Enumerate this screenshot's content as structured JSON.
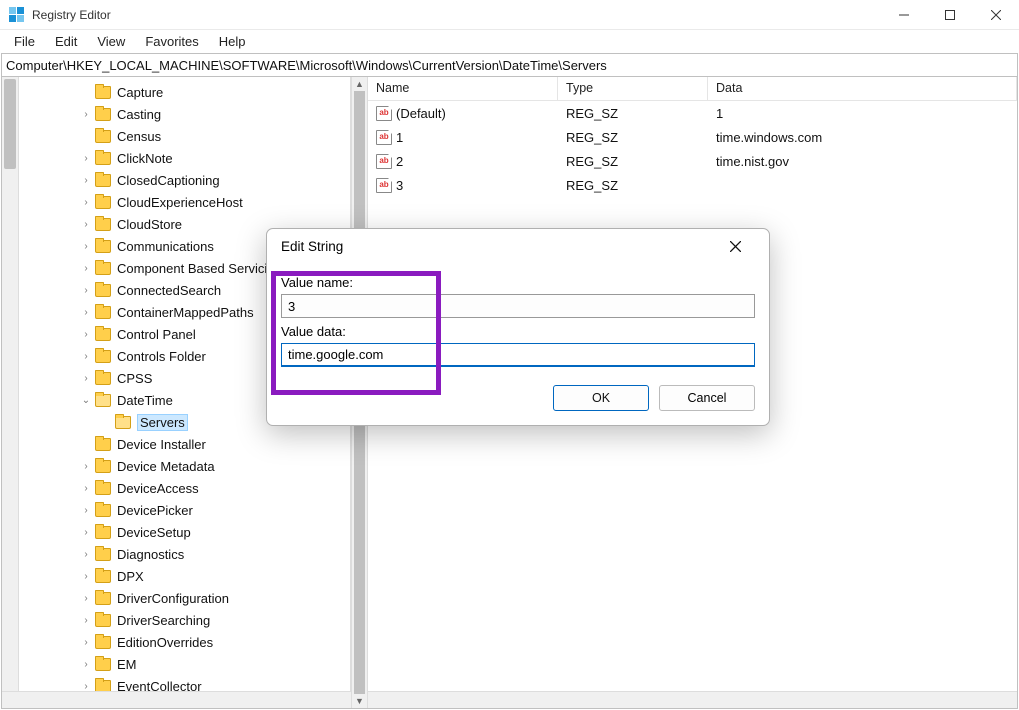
{
  "window": {
    "title": "Registry Editor"
  },
  "menu": {
    "file": "File",
    "edit": "Edit",
    "view": "View",
    "favorites": "Favorites",
    "help": "Help"
  },
  "address": "Computer\\HKEY_LOCAL_MACHINE\\SOFTWARE\\Microsoft\\Windows\\CurrentVersion\\DateTime\\Servers",
  "tree": [
    {
      "label": "Capture",
      "exp": ""
    },
    {
      "label": "Casting",
      "exp": ">"
    },
    {
      "label": "Census",
      "exp": ""
    },
    {
      "label": "ClickNote",
      "exp": ">"
    },
    {
      "label": "ClosedCaptioning",
      "exp": ">"
    },
    {
      "label": "CloudExperienceHost",
      "exp": ">"
    },
    {
      "label": "CloudStore",
      "exp": ">"
    },
    {
      "label": "Communications",
      "exp": ">"
    },
    {
      "label": "Component Based Servicing",
      "exp": ">"
    },
    {
      "label": "ConnectedSearch",
      "exp": ">"
    },
    {
      "label": "ContainerMappedPaths",
      "exp": ">"
    },
    {
      "label": "Control Panel",
      "exp": ">"
    },
    {
      "label": "Controls Folder",
      "exp": ">"
    },
    {
      "label": "CPSS",
      "exp": ">"
    },
    {
      "label": "DateTime",
      "exp": "v",
      "open": true
    },
    {
      "label": "Servers",
      "exp": "",
      "depth": 2,
      "selected": true
    },
    {
      "label": "Device Installer",
      "exp": ""
    },
    {
      "label": "Device Metadata",
      "exp": ">"
    },
    {
      "label": "DeviceAccess",
      "exp": ">"
    },
    {
      "label": "DevicePicker",
      "exp": ">"
    },
    {
      "label": "DeviceSetup",
      "exp": ">"
    },
    {
      "label": "Diagnostics",
      "exp": ">"
    },
    {
      "label": "DPX",
      "exp": ">"
    },
    {
      "label": "DriverConfiguration",
      "exp": ">"
    },
    {
      "label": "DriverSearching",
      "exp": ">"
    },
    {
      "label": "EditionOverrides",
      "exp": ">"
    },
    {
      "label": "EM",
      "exp": ">"
    },
    {
      "label": "EventCollector",
      "exp": ">"
    }
  ],
  "columns": {
    "name": "Name",
    "type": "Type",
    "data": "Data"
  },
  "values": [
    {
      "name": "(Default)",
      "type": "REG_SZ",
      "data": "1"
    },
    {
      "name": "1",
      "type": "REG_SZ",
      "data": "time.windows.com"
    },
    {
      "name": "2",
      "type": "REG_SZ",
      "data": "time.nist.gov"
    },
    {
      "name": "3",
      "type": "REG_SZ",
      "data": ""
    }
  ],
  "dialog": {
    "title": "Edit String",
    "value_name_label": "Value name:",
    "value_name": "3",
    "value_data_label": "Value data:",
    "value_data": "time.google.com",
    "ok": "OK",
    "cancel": "Cancel"
  }
}
